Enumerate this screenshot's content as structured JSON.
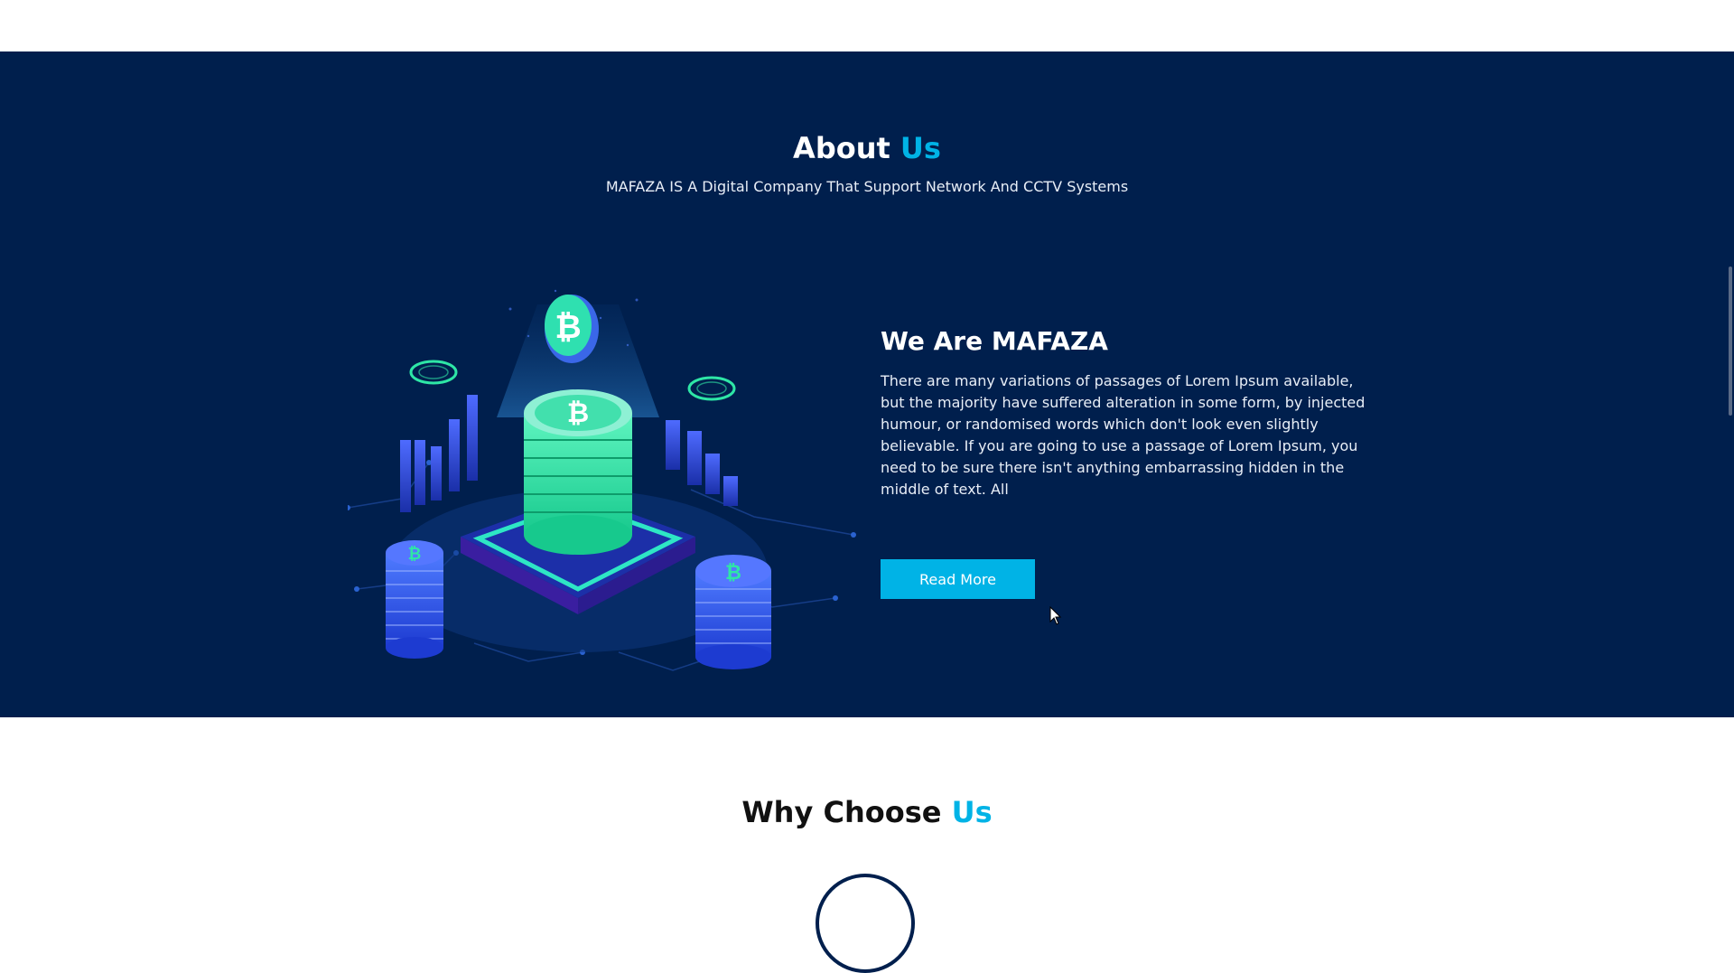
{
  "about": {
    "title_main": "About",
    "title_accent": "Us",
    "subtitle": "MAFAZA IS A Digital Company That Support Network And CCTV Systems",
    "heading": "We Are MAFAZA",
    "body": "There are many variations of passages of Lorem Ipsum available, but the majority have suffered alteration in some form, by injected humour, or randomised words which don't look even slightly believable. If you are going to use a passage of Lorem Ipsum, you need to be sure there isn't anything embarrassing hidden in the middle of text. All",
    "read_more_label": "Read More",
    "illustration_icon": "crypto-coin-stack-illustration"
  },
  "why": {
    "title_main": "Why Choose",
    "title_accent": "Us"
  },
  "colors": {
    "section_bg": "#001f4d",
    "accent": "#00b3e6",
    "coin_green": "#2ee6a6",
    "bar_blue": "#3a55e6"
  }
}
